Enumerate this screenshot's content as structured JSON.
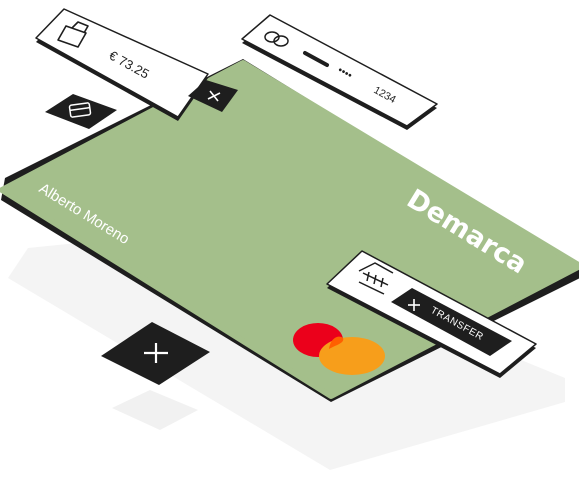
{
  "card": {
    "holder_name": "Alberto Moreno",
    "brand_name": "Demarca",
    "network_icon": "mastercard-logo",
    "color": "#a4bf8b"
  },
  "balance_panel": {
    "amount": "€ 73.25",
    "icon": "wallet-icon",
    "add_icon": "plus-icon"
  },
  "card_number_panel": {
    "masked_dots": "••••",
    "last_digits": "1234",
    "icon": "linked-cards-icon"
  },
  "transfer_panel": {
    "icon": "bank-icon",
    "button_label": "TRANSFER",
    "button_icon": "plus-icon"
  },
  "floating_tiles": {
    "card_tile_icon": "credit-card-icon",
    "add_tile_icon": "plus-icon"
  },
  "colors": {
    "dark": "#1e1e1e",
    "mastercard_red": "#eb001b",
    "mastercard_orange": "#f79e1b"
  }
}
